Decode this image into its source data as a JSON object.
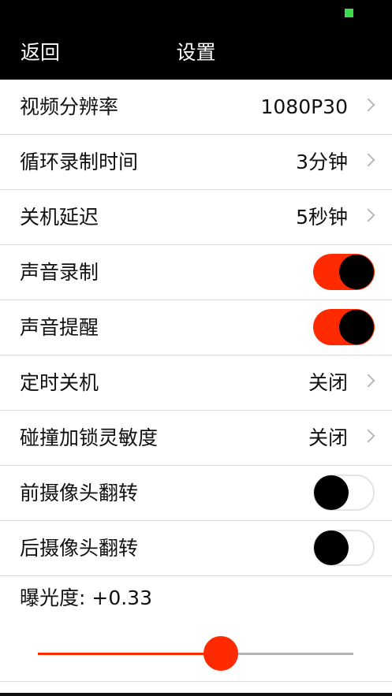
{
  "nav": {
    "back_label": "返回",
    "title": "设置"
  },
  "rows": [
    {
      "label": "视频分辨率",
      "value": "1080P30"
    },
    {
      "label": "循环录制时间",
      "value": "3分钟"
    },
    {
      "label": "关机延迟",
      "value": "5秒钟"
    },
    {
      "label": "声音录制",
      "toggle": true
    },
    {
      "label": "声音提醒",
      "toggle": true
    },
    {
      "label": "定时关机",
      "value": "关闭"
    },
    {
      "label": "碰撞加锁灵敏度",
      "value": "关闭"
    },
    {
      "label": "前摄像头翻转",
      "toggle": false
    },
    {
      "label": "后摄像头翻转",
      "toggle": false
    }
  ],
  "exposure": {
    "label": "曝光度: +0.33",
    "fraction": 0.58
  },
  "colors": {
    "accent": "#ff2a00",
    "nav_bg": "#000000",
    "status_indicator": "#3ddc4f"
  }
}
